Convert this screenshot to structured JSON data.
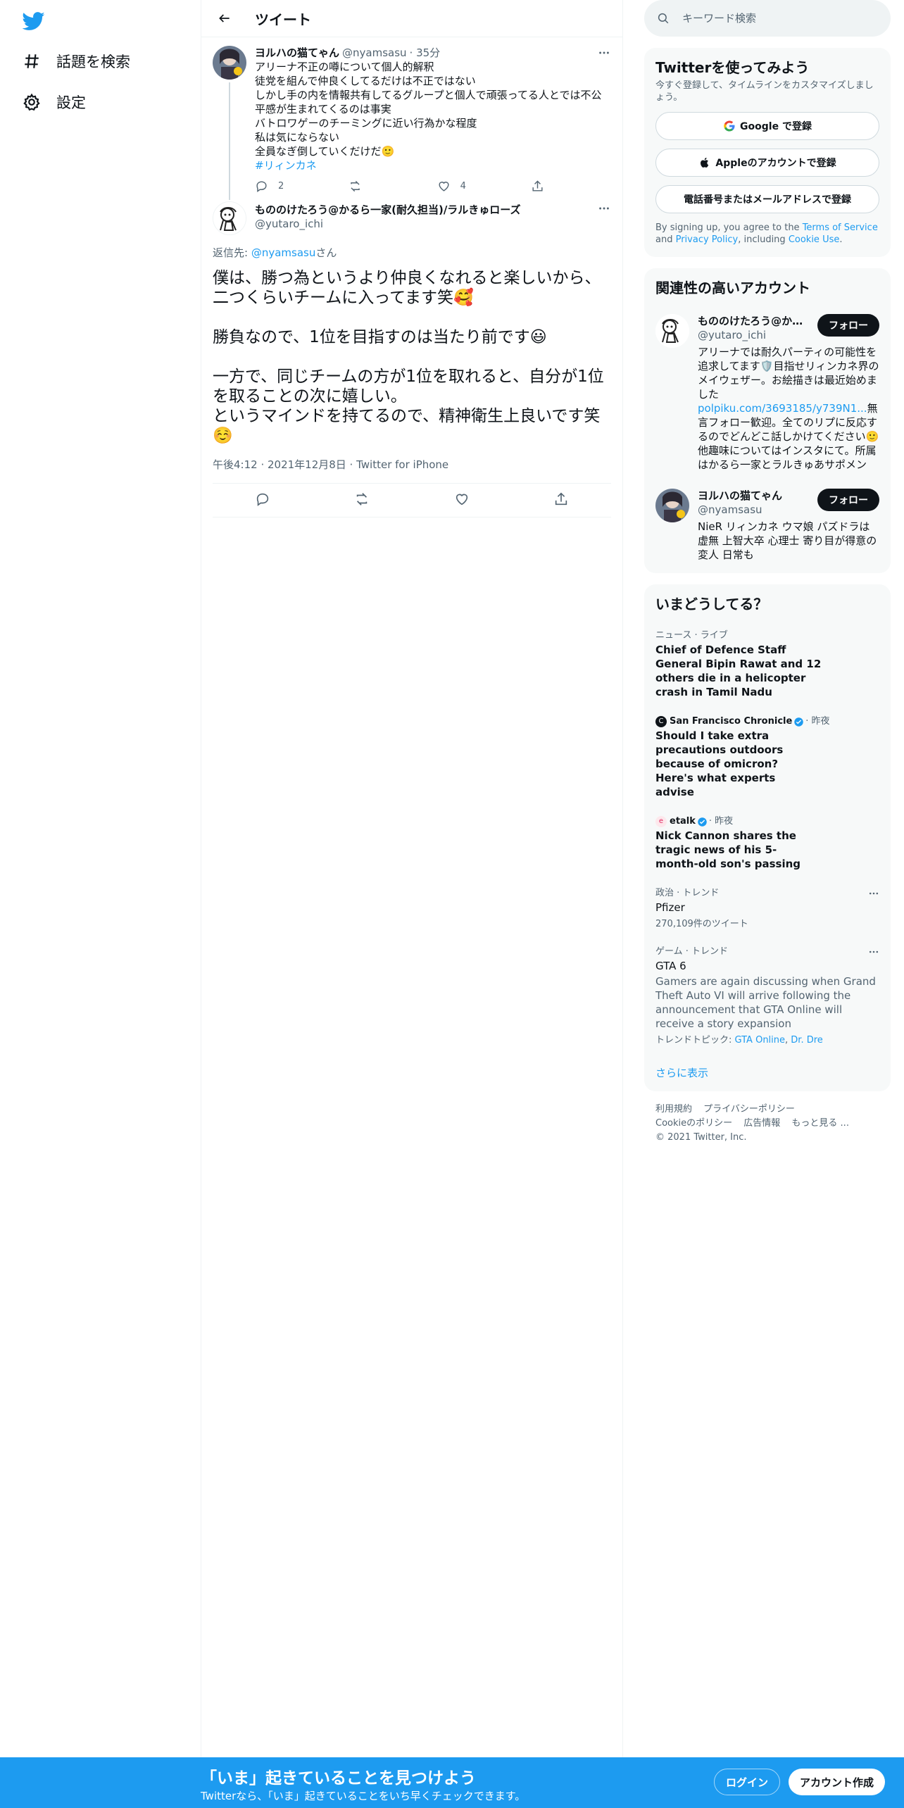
{
  "nav": {
    "items": [
      {
        "icon": "hashtag-icon",
        "label": "話題を検索"
      },
      {
        "icon": "gear-icon",
        "label": "設定"
      }
    ]
  },
  "header": {
    "title": "ツイート"
  },
  "parent_tweet": {
    "name": "ヨルハの猫てゃん",
    "handle": "@nyamsasu",
    "time": "· 35分",
    "lines": [
      "アリーナ不正の噂について個人的解釈",
      "徒党を組んで仲良くしてるだけは不正ではない",
      "しかし手の内を情報共有してるグループと個人で頑張ってる人とでは不公平感が生まれてくるのは事実",
      "バトロワゲーのチーミングに近い行為かな程度",
      "私は気にならない",
      "全員なぎ倒していくだけだ🙂"
    ],
    "hashtag": "#リィンカネ",
    "replies": "2",
    "retweets": "",
    "likes": "4"
  },
  "focus_tweet": {
    "name": "もののけたろう@かるら一家(耐久担当)/ラルきゅローズ",
    "handle": "@yutaro_ichi",
    "reply_label": "返信先: ",
    "reply_handle": "@nyamsasu",
    "reply_suffix": "さん",
    "text": "僕は、勝つ為というより仲良くなれると楽しいから、二つくらいチームに入ってます笑🥰\n\n勝負なので、1位を目指すのは当たり前です😃\n\n一方で、同じチームの方が1位を取れると、自分が1位を取ることの次に嬉しい。\nというマインドを持てるので、精神衛生上良いです笑☺️",
    "meta": "午後4:12 · 2021年12月8日 · Twitter for iPhone"
  },
  "search": {
    "placeholder": "キーワード検索"
  },
  "signup": {
    "title": "Twitterを使ってみよう",
    "subtitle": "今すぐ登録して、タイムラインをカスタマイズしましょう。",
    "google": "Google で登録",
    "apple": "Appleのアカウントで登録",
    "phone": "電話番号またはメールアドレスで登録",
    "terms_prefix": "By signing up, you agree to the ",
    "terms_link": "Terms of Service",
    "terms_and": " and ",
    "privacy_link": "Privacy Policy",
    "terms_including": ", including ",
    "cookie_link": "Cookie Use",
    "terms_end": "."
  },
  "related": {
    "title": "関連性の高いアカウント",
    "accounts": [
      {
        "name": "もののけたろう@か...",
        "handle": "@yutaro_ichi",
        "bio_a": "アリーナでは耐久パーティの可能性を追求してます🛡️目指せリィンカネ界のメイウェザー。お絵描きは最近始めました",
        "bio_link": "polpiku.com/3693185/y739N1...",
        "bio_b": "無言フォロー歓迎。全てのリプに反応するのでどんどこ話しかけてください🙂 他趣味についてはインスタにて。所属はかるら一家とラルきゅあサポメン",
        "follow": "フォロー"
      },
      {
        "name": "ヨルハの猫てゃん",
        "handle": "@nyamsasu",
        "bio_a": "NieR リィンカネ ウマ娘 パズドラは虚無 上智大卒 心理士 寄り目が得意の変人 日常も",
        "bio_link": "",
        "bio_b": "",
        "follow": "フォロー"
      }
    ]
  },
  "trends": {
    "title": "いまどうしてる？",
    "items": [
      {
        "context": "ニュース · ライブ",
        "title": "Chief of Defence Staff General Bipin Rawat and 12 others die in a helicopter crash in Tamil Nadu"
      },
      {
        "source": "San Francisco Chronicle",
        "when": "· 昨夜",
        "title": "Should I take extra precautions outdoors because of omicron? Here's what experts advise"
      },
      {
        "source": "etalk",
        "when": "· 昨夜",
        "title": "Nick Cannon shares the tragic news of his 5-month-old son's passing"
      },
      {
        "context": "政治 · トレンド",
        "title": "Pfizer",
        "sub": "270,109件のツイート"
      },
      {
        "context": "ゲーム · トレンド",
        "title": "GTA 6",
        "desc": "Gamers are again discussing when Grand Theft Auto VI will arrive following the announcement that GTA Online will receive a story expansion",
        "topics_label": "トレンドトピック: ",
        "topic1": "GTA Online",
        "topic_sep": ", ",
        "topic2": "Dr. Dre"
      }
    ],
    "show_more": "さらに表示"
  },
  "footer": {
    "links": [
      "利用規約",
      "プライバシーポリシー",
      "Cookieのポリシー",
      "広告情報",
      "もっと見る ..."
    ],
    "copyright": "© 2021 Twitter, Inc."
  },
  "bottombar": {
    "title": "「いま」起きていることを見つけよう",
    "subtitle": "Twitterなら、「いま」起きていることをいち早くチェックできます。",
    "login": "ログイン",
    "signup": "アカウント作成"
  },
  "colors": {
    "accent": "#1d9bf0",
    "text": "#0f1419",
    "muted": "#536471",
    "border": "#eff3f4"
  }
}
